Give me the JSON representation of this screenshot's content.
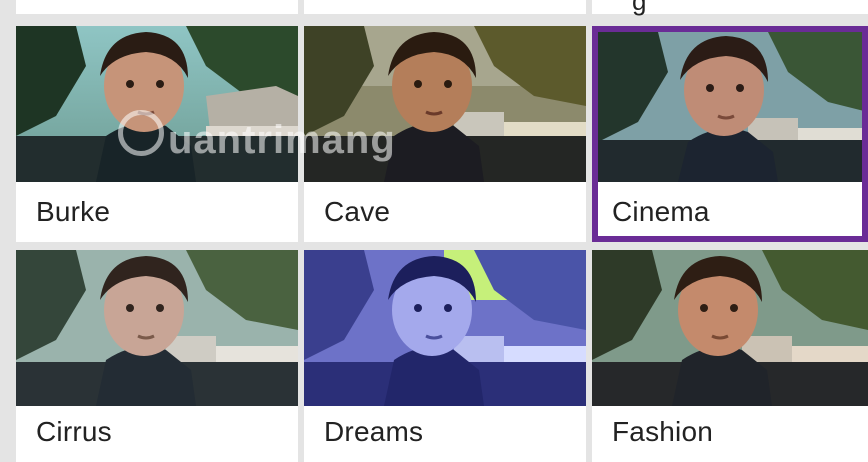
{
  "filters": [
    {
      "label": "Burke",
      "selected": false,
      "tint": "burke"
    },
    {
      "label": "Cave",
      "selected": false,
      "tint": "cave"
    },
    {
      "label": "Cinema",
      "selected": true,
      "tint": "cinema"
    },
    {
      "label": "Cirrus",
      "selected": false,
      "tint": "cirrus"
    },
    {
      "label": "Dreams",
      "selected": false,
      "tint": "dreams"
    },
    {
      "label": "Fashion",
      "selected": false,
      "tint": "fashion"
    }
  ],
  "top_partial_text": "g",
  "watermark": "uantrimang",
  "colors": {
    "selected_border": "#6a2c96",
    "background": "#e4e4e4",
    "tile": "#ffffff"
  }
}
